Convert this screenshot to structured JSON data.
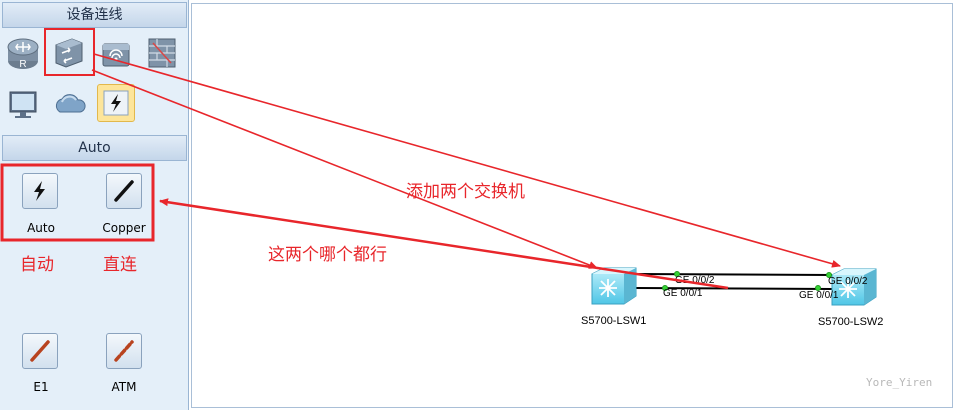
{
  "sidebar": {
    "devices_header": "设备连线",
    "cables_header": "Auto",
    "device_icons": [
      "router-icon",
      "switch-icon",
      "wireless-icon",
      "firewall-icon",
      "pc-icon",
      "cloud-icon",
      "auto-connect-icon"
    ],
    "cables": [
      {
        "label": "Auto",
        "icon": "auto-cable-icon"
      },
      {
        "label": "Copper",
        "icon": "copper-cable-icon"
      },
      {
        "label": "E1",
        "icon": "e1-cable-icon"
      },
      {
        "label": "ATM",
        "icon": "atm-cable-icon"
      }
    ]
  },
  "annotations": {
    "auto": "自动",
    "copper": "直连",
    "add_switches": "添加两个交换机",
    "either_ok": "这两个哪个都行"
  },
  "topology": {
    "lsw1_name": "S5700-LSW1",
    "lsw2_name": "S5700-LSW2",
    "lsw1_port_top": "GE 0/0/2",
    "lsw1_port_bottom": "GE 0/0/1",
    "lsw2_port_top": "GE 0/0/2",
    "lsw2_port_bottom": "GE 0/0/1"
  },
  "watermark": "Yore_Yiren",
  "colors": {
    "annotation_red": "#e8262b",
    "panel_bg": "#e4eff9",
    "port_up": "#35d235"
  }
}
